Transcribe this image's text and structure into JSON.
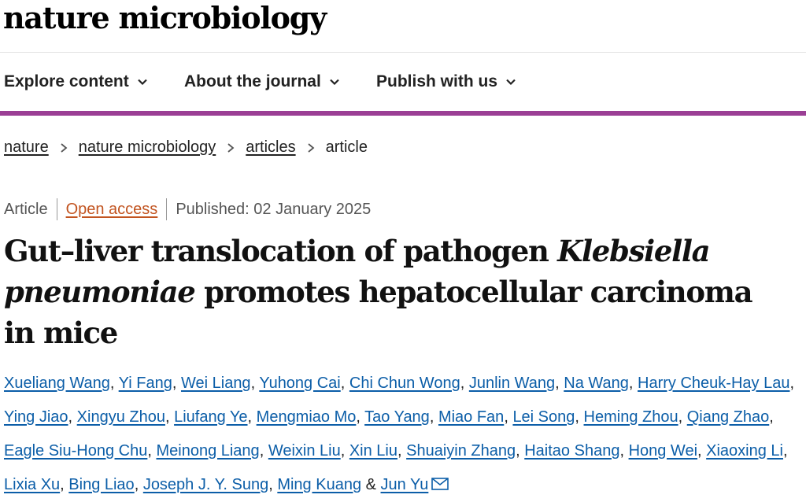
{
  "brand": {
    "name": "nature microbiology"
  },
  "nav": {
    "items": [
      {
        "label": "Explore content"
      },
      {
        "label": "About the journal"
      },
      {
        "label": "Publish with us"
      }
    ]
  },
  "breadcrumb": {
    "items": [
      "nature",
      "nature microbiology",
      "articles"
    ],
    "current": "article"
  },
  "article_meta": {
    "type": "Article",
    "access": "Open access",
    "published": "Published: 02 January 2025"
  },
  "title": {
    "part1": "Gut–liver translocation of pathogen ",
    "italic": "Klebsiella pneumoniae",
    "part2": " promotes hepatocellular carcinoma in mice"
  },
  "authors": [
    "Xueliang Wang",
    "Yi Fang",
    "Wei Liang",
    "Yuhong Cai",
    "Chi Chun Wong",
    "Junlin Wang",
    "Na Wang",
    "Harry Cheuk-Hay Lau",
    "Ying Jiao",
    "Xingyu Zhou",
    "Liufang Ye",
    "Mengmiao Mo",
    "Tao Yang",
    "Miao Fan",
    "Lei Song",
    "Heming Zhou",
    "Qiang Zhao",
    "Eagle Siu-Hong Chu",
    "Meinong Liang",
    "Weixin Liu",
    "Xin Liu",
    "Shuaiyin Zhang",
    "Haitao Shang",
    "Hong Wei",
    "Xiaoxing Li",
    "Lixia Xu",
    "Bing Liao",
    "Joseph J. Y. Sung",
    "Ming Kuang",
    "Jun Yu"
  ],
  "authors_last_separator": "&",
  "icons": {
    "nav_chevron": "chevron-down-icon",
    "crumb_sep": "chevron-right-icon",
    "contact": "mail-icon"
  },
  "colors": {
    "accent": "#9b3f95",
    "link": "#0c5ea8",
    "open_access": "#c25420"
  }
}
